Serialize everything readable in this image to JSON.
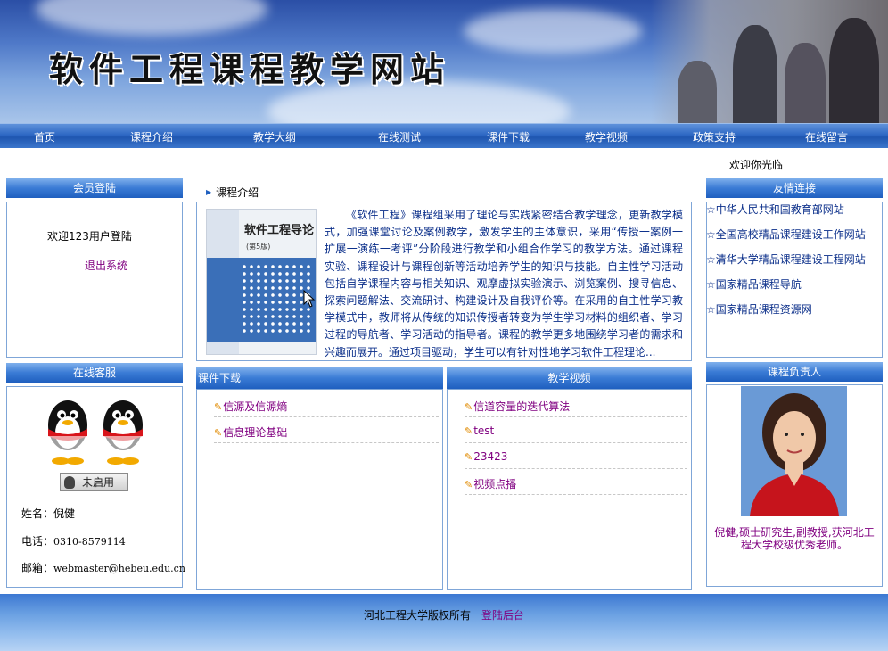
{
  "header": {
    "site_title": "软件工程课程教学网站"
  },
  "nav": [
    {
      "label": "首页"
    },
    {
      "label": "课程介绍"
    },
    {
      "label": "教学大纲"
    },
    {
      "label": "在线测试"
    },
    {
      "label": "课件下载"
    },
    {
      "label": "教学视频"
    },
    {
      "label": "政策支持"
    },
    {
      "label": "在线留言"
    }
  ],
  "welcome_bar": "欢迎你光临",
  "login": {
    "title": "会员登陆",
    "welcome": "欢迎123用户登陆",
    "logout": "退出系统"
  },
  "service": {
    "title": "在线客服",
    "qq_button": "未启用",
    "name_label": "姓名：",
    "name": "倪健",
    "phone_label": "电话：",
    "phone": "0310-8579114",
    "email_label": "邮箱：",
    "email": "webmaster@hebeu.edu.cn"
  },
  "intro": {
    "title": "课程介绍",
    "book_title": "软件工程导论",
    "book_edition": "(第5版)",
    "text": "《软件工程》课程组采用了理论与实践紧密结合教学理念，更新教学模式，加强课堂讨论及案例教学，激发学生的主体意识，采用“传授一案例一扩展一演练一考评”分阶段进行教学和小组合作学习的教学方法。通过课程实验、课程设计与课程创新等活动培养学生的知识与技能。自主性学习活动包括自学课程内容与相关知识、观摩虚拟实验演示、浏览案例、搜寻信息、探索问题解法、交流研讨、构建设计及自我评价等。在采用的自主性学习教学模式中，教师将从传统的知识传授者转变为学生学习材料的组织者、学习过程的导航者、学习活动的指导者。课程的教学更多地围绕学习者的需求和兴趣而展开。通过项目驱动，学生可以有针对性地学习软件工程理论..."
  },
  "downloads": {
    "title": "课件下载",
    "items": [
      {
        "label": "信源及信源熵"
      },
      {
        "label": "信息理论基础"
      }
    ]
  },
  "videos": {
    "title": "教学视频",
    "items": [
      {
        "label": "信道容量的迭代算法"
      },
      {
        "label": "test"
      },
      {
        "label": "23423"
      },
      {
        "label": "视频点播"
      }
    ]
  },
  "friends": {
    "title": "友情连接",
    "items": [
      {
        "label": "☆中华人民共和国教育部网站"
      },
      {
        "label": "☆全国高校精品课程建设工作网站"
      },
      {
        "label": "☆清华大学精品课程建设工程网站"
      },
      {
        "label": "☆国家精品课程导航"
      },
      {
        "label": "☆国家精品课程资源网"
      }
    ]
  },
  "teacher": {
    "title": "课程负责人",
    "desc": "倪健,硕士研究生,副教授,获河北工程大学校级优秀老师。"
  },
  "footer": {
    "copyright": "河北工程大学版权所有",
    "admin_link": "登陆后台"
  },
  "colors": {
    "nav_blue": "#2e68c4",
    "link_purple": "#800080",
    "text_blue": "#0b2f8a"
  }
}
